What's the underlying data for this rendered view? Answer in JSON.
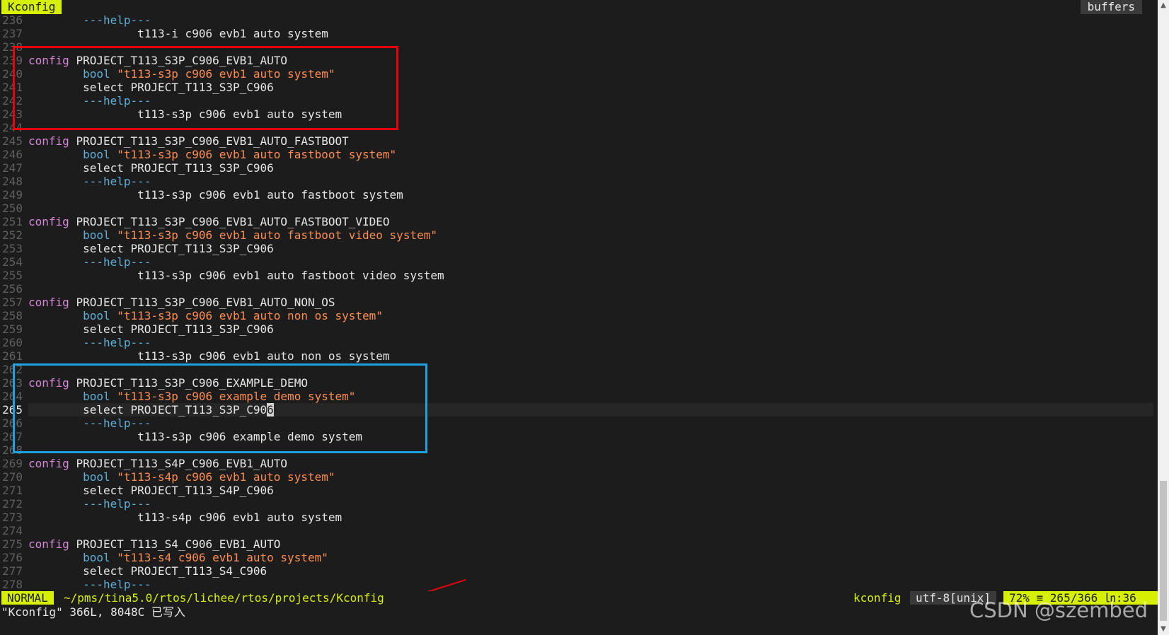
{
  "tabline": {
    "tab_label": "Kconfig",
    "buffers_label": "buffers"
  },
  "lines": [
    {
      "n": "236",
      "segs": [
        {
          "c": "kw-help",
          "t": "        ---help---"
        }
      ]
    },
    {
      "n": "237",
      "segs": [
        {
          "c": "plain",
          "t": "                t113-i c906 evb1 auto system"
        }
      ]
    },
    {
      "n": "238",
      "segs": []
    },
    {
      "n": "239",
      "segs": [
        {
          "c": "kw-config",
          "t": "config "
        },
        {
          "c": "ident",
          "t": "PROJECT_T113_S3P_C906_EVB1_AUTO"
        }
      ]
    },
    {
      "n": "240",
      "segs": [
        {
          "c": "kw-bool",
          "t": "        bool "
        },
        {
          "c": "str",
          "t": "\"t113-s3p c906 evb1 auto system\""
        }
      ]
    },
    {
      "n": "241",
      "segs": [
        {
          "c": "kw-select",
          "t": "        select "
        },
        {
          "c": "ident",
          "t": "PROJECT_T113_S3P_C906"
        }
      ]
    },
    {
      "n": "242",
      "segs": [
        {
          "c": "kw-help",
          "t": "        ---help---"
        }
      ]
    },
    {
      "n": "243",
      "segs": [
        {
          "c": "plain",
          "t": "                t113-s3p c906 evb1 auto system"
        }
      ]
    },
    {
      "n": "244",
      "segs": []
    },
    {
      "n": "245",
      "segs": [
        {
          "c": "kw-config",
          "t": "config "
        },
        {
          "c": "ident",
          "t": "PROJECT_T113_S3P_C906_EVB1_AUTO_FASTBOOT"
        }
      ]
    },
    {
      "n": "246",
      "segs": [
        {
          "c": "kw-bool",
          "t": "        bool "
        },
        {
          "c": "str",
          "t": "\"t113-s3p c906 evb1 auto fastboot system\""
        }
      ]
    },
    {
      "n": "247",
      "segs": [
        {
          "c": "kw-select",
          "t": "        select "
        },
        {
          "c": "ident",
          "t": "PROJECT_T113_S3P_C906"
        }
      ]
    },
    {
      "n": "248",
      "segs": [
        {
          "c": "kw-help",
          "t": "        ---help---"
        }
      ]
    },
    {
      "n": "249",
      "segs": [
        {
          "c": "plain",
          "t": "                t113-s3p c906 evb1 auto fastboot system"
        }
      ]
    },
    {
      "n": "250",
      "segs": []
    },
    {
      "n": "251",
      "segs": [
        {
          "c": "kw-config",
          "t": "config "
        },
        {
          "c": "ident",
          "t": "PROJECT_T113_S3P_C906_EVB1_AUTO_FASTBOOT_VIDEO"
        }
      ]
    },
    {
      "n": "252",
      "segs": [
        {
          "c": "kw-bool",
          "t": "        bool "
        },
        {
          "c": "str",
          "t": "\"t113-s3p c906 evb1 auto fastboot video system\""
        }
      ]
    },
    {
      "n": "253",
      "segs": [
        {
          "c": "kw-select",
          "t": "        select "
        },
        {
          "c": "ident",
          "t": "PROJECT_T113_S3P_C906"
        }
      ]
    },
    {
      "n": "254",
      "segs": [
        {
          "c": "kw-help",
          "t": "        ---help---"
        }
      ]
    },
    {
      "n": "255",
      "segs": [
        {
          "c": "plain",
          "t": "                t113-s3p c906 evb1 auto fastboot video system"
        }
      ]
    },
    {
      "n": "256",
      "segs": []
    },
    {
      "n": "257",
      "segs": [
        {
          "c": "kw-config",
          "t": "config "
        },
        {
          "c": "ident",
          "t": "PROJECT_T113_S3P_C906_EVB1_AUTO_NON_OS"
        }
      ]
    },
    {
      "n": "258",
      "segs": [
        {
          "c": "kw-bool",
          "t": "        bool "
        },
        {
          "c": "str",
          "t": "\"t113-s3p c906 evb1 auto non os system\""
        }
      ]
    },
    {
      "n": "259",
      "segs": [
        {
          "c": "kw-select",
          "t": "        select "
        },
        {
          "c": "ident",
          "t": "PROJECT_T113_S3P_C906"
        }
      ]
    },
    {
      "n": "260",
      "segs": [
        {
          "c": "kw-help",
          "t": "        ---help---"
        }
      ]
    },
    {
      "n": "261",
      "segs": [
        {
          "c": "plain",
          "t": "                t113-s3p c906 evb1 auto non os system"
        }
      ]
    },
    {
      "n": "262",
      "segs": []
    },
    {
      "n": "263",
      "segs": [
        {
          "c": "kw-config",
          "t": "config "
        },
        {
          "c": "ident",
          "t": "PROJECT_T113_S3P_C906_EXAMPLE_DEMO"
        }
      ]
    },
    {
      "n": "264",
      "segs": [
        {
          "c": "kw-bool",
          "t": "        bool "
        },
        {
          "c": "str",
          "t": "\"t113-s3p c906 example demo system\""
        }
      ]
    },
    {
      "n": "265",
      "current": true,
      "segs": [
        {
          "c": "kw-select",
          "t": "        select "
        },
        {
          "c": "ident",
          "t": "PROJECT_T113_S3P_C90"
        },
        {
          "c": "cursor",
          "t": "6"
        }
      ]
    },
    {
      "n": "266",
      "segs": [
        {
          "c": "kw-help",
          "t": "        ---help---"
        }
      ]
    },
    {
      "n": "267",
      "segs": [
        {
          "c": "plain",
          "t": "                t113-s3p c906 example demo system"
        }
      ]
    },
    {
      "n": "268",
      "segs": []
    },
    {
      "n": "269",
      "segs": [
        {
          "c": "kw-config",
          "t": "config "
        },
        {
          "c": "ident",
          "t": "PROJECT_T113_S4P_C906_EVB1_AUTO"
        }
      ]
    },
    {
      "n": "270",
      "segs": [
        {
          "c": "kw-bool",
          "t": "        bool "
        },
        {
          "c": "str",
          "t": "\"t113-s4p c906 evb1 auto system\""
        }
      ]
    },
    {
      "n": "271",
      "segs": [
        {
          "c": "kw-select",
          "t": "        select "
        },
        {
          "c": "ident",
          "t": "PROJECT_T113_S4P_C906"
        }
      ]
    },
    {
      "n": "272",
      "segs": [
        {
          "c": "kw-help",
          "t": "        ---help---"
        }
      ]
    },
    {
      "n": "273",
      "segs": [
        {
          "c": "plain",
          "t": "                t113-s4p c906 evb1 auto system"
        }
      ]
    },
    {
      "n": "274",
      "segs": []
    },
    {
      "n": "275",
      "segs": [
        {
          "c": "kw-config",
          "t": "config "
        },
        {
          "c": "ident",
          "t": "PROJECT_T113_S4_C906_EVB1_AUTO"
        }
      ]
    },
    {
      "n": "276",
      "segs": [
        {
          "c": "kw-bool",
          "t": "        bool "
        },
        {
          "c": "str",
          "t": "\"t113-s4 c906 evb1 auto system\""
        }
      ]
    },
    {
      "n": "277",
      "segs": [
        {
          "c": "kw-select",
          "t": "        select "
        },
        {
          "c": "ident",
          "t": "PROJECT_T113_S4_C906"
        }
      ]
    },
    {
      "n": "278",
      "segs": [
        {
          "c": "kw-help",
          "t": "        ---help---"
        }
      ]
    }
  ],
  "statusline": {
    "mode": "NORMAL",
    "filepath": "~/pms/tina5.0/rtos/lichee/rtos/projects/Kconfig",
    "filetype": "kconfig",
    "encoding": "utf-8[unix]",
    "position": "72% ≡ 265/366 ㏑:36"
  },
  "cmdline": {
    "message": "\"Kconfig\" 366L, 8048C 已写入"
  },
  "watermark": "CSDN @szembed",
  "colors": {
    "accent_yellow": "#d7f000",
    "red_box": "#e8000d",
    "blue_box": "#1aa3e0",
    "keyword_magenta": "#d787d7",
    "keyword_blue": "#5fafd7",
    "string_orange": "#ff8d52"
  }
}
